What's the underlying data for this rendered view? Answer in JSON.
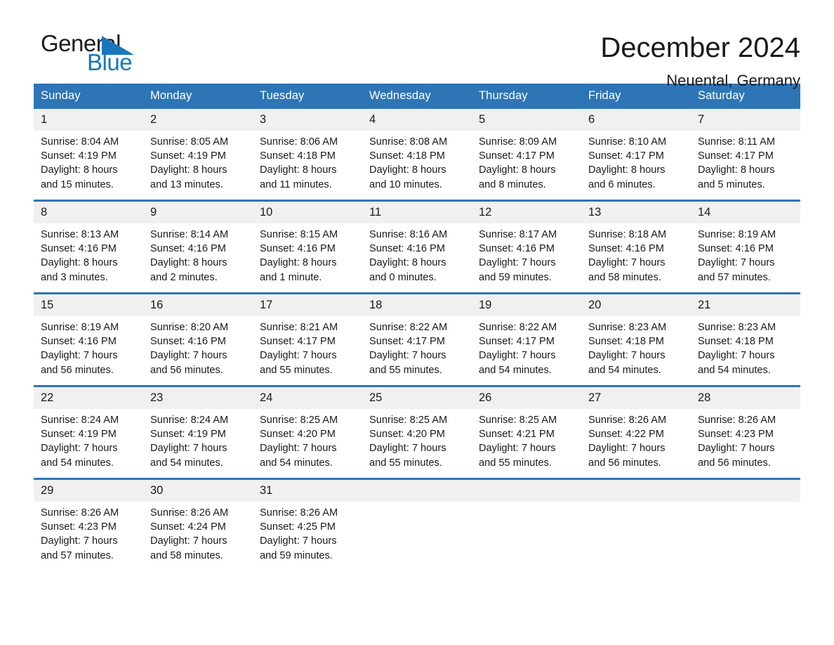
{
  "brand": {
    "name_part1": "General",
    "name_part2": "Blue",
    "flag_icon": "brand-flag-icon"
  },
  "header": {
    "month_title": "December 2024",
    "location": "Neuental, Germany"
  },
  "colors": {
    "header_blue": "#2e75b6",
    "brand_blue": "#1479bd",
    "daynum_band": "#f0f0f0",
    "text": "#1a1a1a",
    "page_background": "#ffffff"
  },
  "calendar": {
    "weekday_headers": [
      "Sunday",
      "Monday",
      "Tuesday",
      "Wednesday",
      "Thursday",
      "Friday",
      "Saturday"
    ],
    "weeks": [
      [
        {
          "day": "1",
          "sunrise": "Sunrise: 8:04 AM",
          "sunset": "Sunset: 4:19 PM",
          "daylight_line1": "Daylight: 8 hours",
          "daylight_line2": "and 15 minutes."
        },
        {
          "day": "2",
          "sunrise": "Sunrise: 8:05 AM",
          "sunset": "Sunset: 4:19 PM",
          "daylight_line1": "Daylight: 8 hours",
          "daylight_line2": "and 13 minutes."
        },
        {
          "day": "3",
          "sunrise": "Sunrise: 8:06 AM",
          "sunset": "Sunset: 4:18 PM",
          "daylight_line1": "Daylight: 8 hours",
          "daylight_line2": "and 11 minutes."
        },
        {
          "day": "4",
          "sunrise": "Sunrise: 8:08 AM",
          "sunset": "Sunset: 4:18 PM",
          "daylight_line1": "Daylight: 8 hours",
          "daylight_line2": "and 10 minutes."
        },
        {
          "day": "5",
          "sunrise": "Sunrise: 8:09 AM",
          "sunset": "Sunset: 4:17 PM",
          "daylight_line1": "Daylight: 8 hours",
          "daylight_line2": "and 8 minutes."
        },
        {
          "day": "6",
          "sunrise": "Sunrise: 8:10 AM",
          "sunset": "Sunset: 4:17 PM",
          "daylight_line1": "Daylight: 8 hours",
          "daylight_line2": "and 6 minutes."
        },
        {
          "day": "7",
          "sunrise": "Sunrise: 8:11 AM",
          "sunset": "Sunset: 4:17 PM",
          "daylight_line1": "Daylight: 8 hours",
          "daylight_line2": "and 5 minutes."
        }
      ],
      [
        {
          "day": "8",
          "sunrise": "Sunrise: 8:13 AM",
          "sunset": "Sunset: 4:16 PM",
          "daylight_line1": "Daylight: 8 hours",
          "daylight_line2": "and 3 minutes."
        },
        {
          "day": "9",
          "sunrise": "Sunrise: 8:14 AM",
          "sunset": "Sunset: 4:16 PM",
          "daylight_line1": "Daylight: 8 hours",
          "daylight_line2": "and 2 minutes."
        },
        {
          "day": "10",
          "sunrise": "Sunrise: 8:15 AM",
          "sunset": "Sunset: 4:16 PM",
          "daylight_line1": "Daylight: 8 hours",
          "daylight_line2": "and 1 minute."
        },
        {
          "day": "11",
          "sunrise": "Sunrise: 8:16 AM",
          "sunset": "Sunset: 4:16 PM",
          "daylight_line1": "Daylight: 8 hours",
          "daylight_line2": "and 0 minutes."
        },
        {
          "day": "12",
          "sunrise": "Sunrise: 8:17 AM",
          "sunset": "Sunset: 4:16 PM",
          "daylight_line1": "Daylight: 7 hours",
          "daylight_line2": "and 59 minutes."
        },
        {
          "day": "13",
          "sunrise": "Sunrise: 8:18 AM",
          "sunset": "Sunset: 4:16 PM",
          "daylight_line1": "Daylight: 7 hours",
          "daylight_line2": "and 58 minutes."
        },
        {
          "day": "14",
          "sunrise": "Sunrise: 8:19 AM",
          "sunset": "Sunset: 4:16 PM",
          "daylight_line1": "Daylight: 7 hours",
          "daylight_line2": "and 57 minutes."
        }
      ],
      [
        {
          "day": "15",
          "sunrise": "Sunrise: 8:19 AM",
          "sunset": "Sunset: 4:16 PM",
          "daylight_line1": "Daylight: 7 hours",
          "daylight_line2": "and 56 minutes."
        },
        {
          "day": "16",
          "sunrise": "Sunrise: 8:20 AM",
          "sunset": "Sunset: 4:16 PM",
          "daylight_line1": "Daylight: 7 hours",
          "daylight_line2": "and 56 minutes."
        },
        {
          "day": "17",
          "sunrise": "Sunrise: 8:21 AM",
          "sunset": "Sunset: 4:17 PM",
          "daylight_line1": "Daylight: 7 hours",
          "daylight_line2": "and 55 minutes."
        },
        {
          "day": "18",
          "sunrise": "Sunrise: 8:22 AM",
          "sunset": "Sunset: 4:17 PM",
          "daylight_line1": "Daylight: 7 hours",
          "daylight_line2": "and 55 minutes."
        },
        {
          "day": "19",
          "sunrise": "Sunrise: 8:22 AM",
          "sunset": "Sunset: 4:17 PM",
          "daylight_line1": "Daylight: 7 hours",
          "daylight_line2": "and 54 minutes."
        },
        {
          "day": "20",
          "sunrise": "Sunrise: 8:23 AM",
          "sunset": "Sunset: 4:18 PM",
          "daylight_line1": "Daylight: 7 hours",
          "daylight_line2": "and 54 minutes."
        },
        {
          "day": "21",
          "sunrise": "Sunrise: 8:23 AM",
          "sunset": "Sunset: 4:18 PM",
          "daylight_line1": "Daylight: 7 hours",
          "daylight_line2": "and 54 minutes."
        }
      ],
      [
        {
          "day": "22",
          "sunrise": "Sunrise: 8:24 AM",
          "sunset": "Sunset: 4:19 PM",
          "daylight_line1": "Daylight: 7 hours",
          "daylight_line2": "and 54 minutes."
        },
        {
          "day": "23",
          "sunrise": "Sunrise: 8:24 AM",
          "sunset": "Sunset: 4:19 PM",
          "daylight_line1": "Daylight: 7 hours",
          "daylight_line2": "and 54 minutes."
        },
        {
          "day": "24",
          "sunrise": "Sunrise: 8:25 AM",
          "sunset": "Sunset: 4:20 PM",
          "daylight_line1": "Daylight: 7 hours",
          "daylight_line2": "and 54 minutes."
        },
        {
          "day": "25",
          "sunrise": "Sunrise: 8:25 AM",
          "sunset": "Sunset: 4:20 PM",
          "daylight_line1": "Daylight: 7 hours",
          "daylight_line2": "and 55 minutes."
        },
        {
          "day": "26",
          "sunrise": "Sunrise: 8:25 AM",
          "sunset": "Sunset: 4:21 PM",
          "daylight_line1": "Daylight: 7 hours",
          "daylight_line2": "and 55 minutes."
        },
        {
          "day": "27",
          "sunrise": "Sunrise: 8:26 AM",
          "sunset": "Sunset: 4:22 PM",
          "daylight_line1": "Daylight: 7 hours",
          "daylight_line2": "and 56 minutes."
        },
        {
          "day": "28",
          "sunrise": "Sunrise: 8:26 AM",
          "sunset": "Sunset: 4:23 PM",
          "daylight_line1": "Daylight: 7 hours",
          "daylight_line2": "and 56 minutes."
        }
      ],
      [
        {
          "day": "29",
          "sunrise": "Sunrise: 8:26 AM",
          "sunset": "Sunset: 4:23 PM",
          "daylight_line1": "Daylight: 7 hours",
          "daylight_line2": "and 57 minutes."
        },
        {
          "day": "30",
          "sunrise": "Sunrise: 8:26 AM",
          "sunset": "Sunset: 4:24 PM",
          "daylight_line1": "Daylight: 7 hours",
          "daylight_line2": "and 58 minutes."
        },
        {
          "day": "31",
          "sunrise": "Sunrise: 8:26 AM",
          "sunset": "Sunset: 4:25 PM",
          "daylight_line1": "Daylight: 7 hours",
          "daylight_line2": "and 59 minutes."
        },
        {
          "day": "",
          "sunrise": "",
          "sunset": "",
          "daylight_line1": "",
          "daylight_line2": ""
        },
        {
          "day": "",
          "sunrise": "",
          "sunset": "",
          "daylight_line1": "",
          "daylight_line2": ""
        },
        {
          "day": "",
          "sunrise": "",
          "sunset": "",
          "daylight_line1": "",
          "daylight_line2": ""
        },
        {
          "day": "",
          "sunrise": "",
          "sunset": "",
          "daylight_line1": "",
          "daylight_line2": ""
        }
      ]
    ]
  }
}
